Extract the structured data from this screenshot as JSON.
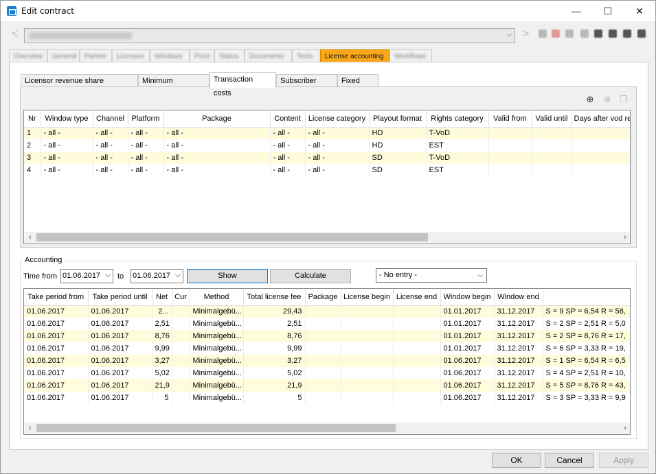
{
  "window": {
    "title": "Edit contract",
    "min": "—",
    "max": "☐",
    "close": "✕"
  },
  "nav": {
    "back": "<",
    "forward": ">",
    "combo_value": "",
    "combo_arrow": "⌵"
  },
  "main_tabs": [
    "Overview",
    "General",
    "Partner",
    "Licenses",
    "Windows",
    "Price",
    "Status",
    "Documents",
    "Texts",
    "License accounting",
    "Workflows"
  ],
  "main_tab_active": "License accounting",
  "sub_tabs": [
    "Licensor revenue share (fallback)",
    "Minimum guarantee",
    "Transaction costs",
    "Subscriber costs",
    "Fixed fees"
  ],
  "sub_tab_active": "Transaction costs",
  "top_grid": {
    "columns": [
      "Nr",
      "Window type",
      "Channel",
      "Platform",
      "Package",
      "Content",
      "License category",
      "Playout format",
      "Rights category",
      "Valid from",
      "Valid until",
      "Days after vod re"
    ],
    "rows": [
      [
        "1",
        "- all -",
        "- all -",
        "- all -",
        "- all -",
        "- all -",
        "- all -",
        "HD",
        "T-VoD",
        "",
        "",
        ""
      ],
      [
        "2",
        "- all -",
        "- all -",
        "- all -",
        "- all -",
        "- all -",
        "- all -",
        "HD",
        "EST",
        "",
        "",
        ""
      ],
      [
        "3",
        "- all -",
        "- all -",
        "- all -",
        "- all -",
        "- all -",
        "- all -",
        "SD",
        "T-VoD",
        "",
        "",
        ""
      ],
      [
        "4",
        "- all -",
        "- all -",
        "- all -",
        "- all -",
        "- all -",
        "- all -",
        "SD",
        "EST",
        "",
        "",
        ""
      ]
    ]
  },
  "accounting": {
    "group_label": "Accounting",
    "time_from_label": "Time from",
    "from_date": "01.06.2017",
    "to_label": "to",
    "to_date": "01.06.2017",
    "show_button": "Show",
    "calculate_button": "Calculate",
    "entry_select": "- No entry -"
  },
  "bottom_grid": {
    "columns": [
      "Take period from",
      "Take period until",
      "Net",
      "Cur",
      "Method",
      "Total license fee",
      "Package",
      "License begin",
      "License end",
      "Window begin",
      "Window end",
      ""
    ],
    "rows": [
      [
        "01.06.2017",
        "01.06.2017",
        "2...",
        "",
        "Minimalgebü...",
        "29,43",
        "",
        "",
        "",
        "01.01.2017",
        "31.12.2017",
        "S = 9 SP = 6,54 R = 58,"
      ],
      [
        "01.06.2017",
        "01.06.2017",
        "2,51",
        "",
        "Minimalgebü...",
        "2,51",
        "",
        "",
        "",
        "01.01.2017",
        "31.12.2017",
        "S = 2 SP = 2,51 R = 5,0"
      ],
      [
        "01.06.2017",
        "01.06.2017",
        "8,76",
        "",
        "Minimalgebü...",
        "8,76",
        "",
        "",
        "",
        "01.01.2017",
        "31.12.2017",
        "S = 2 SP = 8,76 R = 17,"
      ],
      [
        "01.06.2017",
        "01.06.2017",
        "9,99",
        "",
        "Minimalgebü...",
        "9,99",
        "",
        "",
        "",
        "01.01.2017",
        "31.12.2017",
        "S = 6 SP = 3,33 R = 19,"
      ],
      [
        "01.06.2017",
        "01.06.2017",
        "3,27",
        "",
        "Minimalgebü...",
        "3,27",
        "",
        "",
        "",
        "01.06.2017",
        "31.12.2017",
        "S = 1 SP = 6,54 R = 6,5"
      ],
      [
        "01.06.2017",
        "01.06.2017",
        "5,02",
        "",
        "Minimalgebü...",
        "5,02",
        "",
        "",
        "",
        "01.06.2017",
        "31.12.2017",
        "S = 4 SP = 2,51 R = 10,"
      ],
      [
        "01.06.2017",
        "01.06.2017",
        "21,9",
        "",
        "Minimalgebü...",
        "21,9",
        "",
        "",
        "",
        "01.06.2017",
        "31.12.2017",
        "S = 5 SP = 8,76 R = 43,"
      ],
      [
        "01.06.2017",
        "01.06.2017",
        "5",
        "",
        "Minimalgebü...",
        "5",
        "",
        "",
        "",
        "01.06.2017",
        "31.12.2017",
        "S = 3 SP = 3,33 R = 9,9"
      ]
    ]
  },
  "footer": {
    "ok": "OK",
    "cancel": "Cancel",
    "apply": "Apply"
  },
  "colors": {
    "active_tab": "#f8a81a",
    "row_highlight": "#fffcdc",
    "app_icon": "#1a7fd4"
  }
}
